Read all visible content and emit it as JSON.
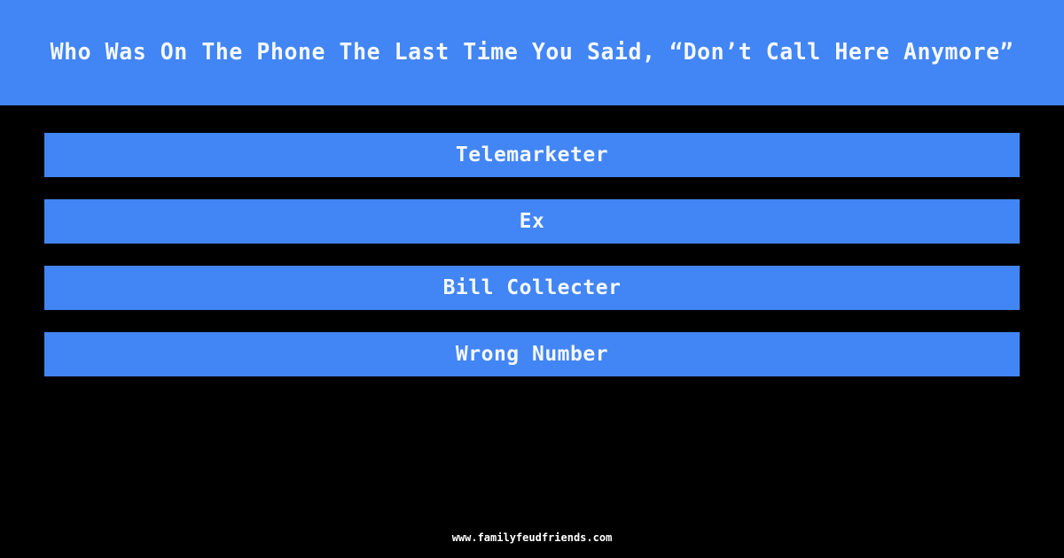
{
  "page": {
    "background_color": "#000000",
    "accent_color": "#4285f4",
    "text_color": "#f4f8ff"
  },
  "header": {
    "question": "Who Was On The Phone The Last Time You Said, “Don’t Call Here Anymore”"
  },
  "answers": [
    {
      "label": "Telemarketer"
    },
    {
      "label": "Ex"
    },
    {
      "label": "Bill Collecter"
    },
    {
      "label": "Wrong Number"
    }
  ],
  "footer": {
    "url": "www.familyfeudfriends.com"
  }
}
